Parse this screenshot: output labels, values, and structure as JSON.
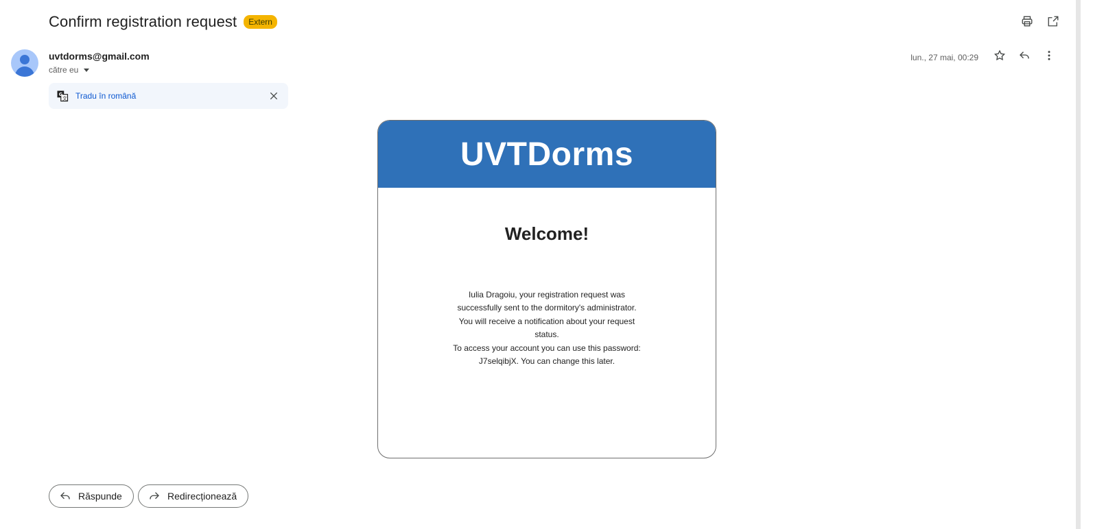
{
  "subject": "Confirm registration request",
  "badge": "Extern",
  "sender": {
    "email": "uvtdorms@gmail.com",
    "to": "către eu",
    "date": "lun., 27 mai, 00:29"
  },
  "translate": {
    "label": "Tradu în română"
  },
  "email_body": {
    "brand": "UVTDorms",
    "heading": "Welcome!",
    "lines": [
      "Iulia Dragoiu, your registration request was",
      "successfully sent to the dormitory's administrator.",
      "You will receive a notification about your request",
      "status.",
      "To access your account you can use this password:",
      "J7selqibjX. You can change this later."
    ]
  },
  "actions": {
    "reply": "Răspunde",
    "forward": "Redirecționează"
  },
  "colors": {
    "brand_header": "#2f71b8",
    "badge": "#f4b400",
    "link": "#0b57d0"
  }
}
